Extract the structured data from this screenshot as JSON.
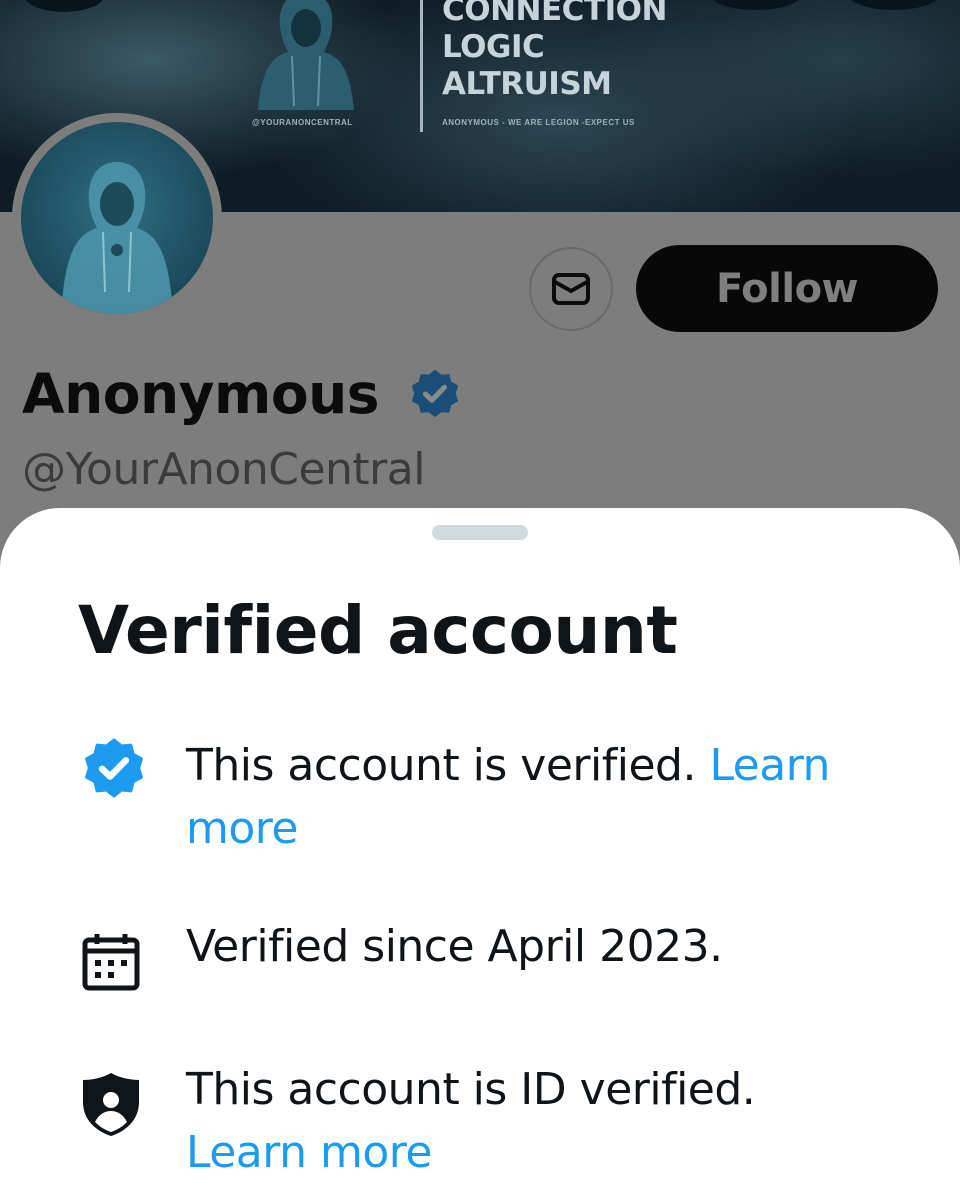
{
  "banner": {
    "lines": [
      "CONNECTION",
      "LOGIC",
      "ALTRUISM"
    ],
    "handle": "@YOURANONCENTRAL",
    "tagline": "ANONYMOUS - WE ARE LEGION -EXPECT US"
  },
  "profile": {
    "name": "Anonymous",
    "handle": "@YourAnonCentral",
    "follow_label": "Follow",
    "message_icon": "envelope-icon",
    "verified_icon": "verified-badge-icon"
  },
  "sheet": {
    "title": "Verified account",
    "rows": [
      {
        "icon": "verified-badge-icon",
        "text": "This account is verified.",
        "link": "Learn more"
      },
      {
        "icon": "calendar-icon",
        "text": "Verified since April 2023."
      },
      {
        "icon": "id-shield-icon",
        "text": "This account is ID verified.",
        "link": "Learn more"
      }
    ]
  },
  "colors": {
    "link": "#1d9bf0",
    "badge": "#1d9bf0",
    "text": "#0f1419",
    "overlay": "#7d7d7d",
    "follow_bg": "#080808"
  }
}
